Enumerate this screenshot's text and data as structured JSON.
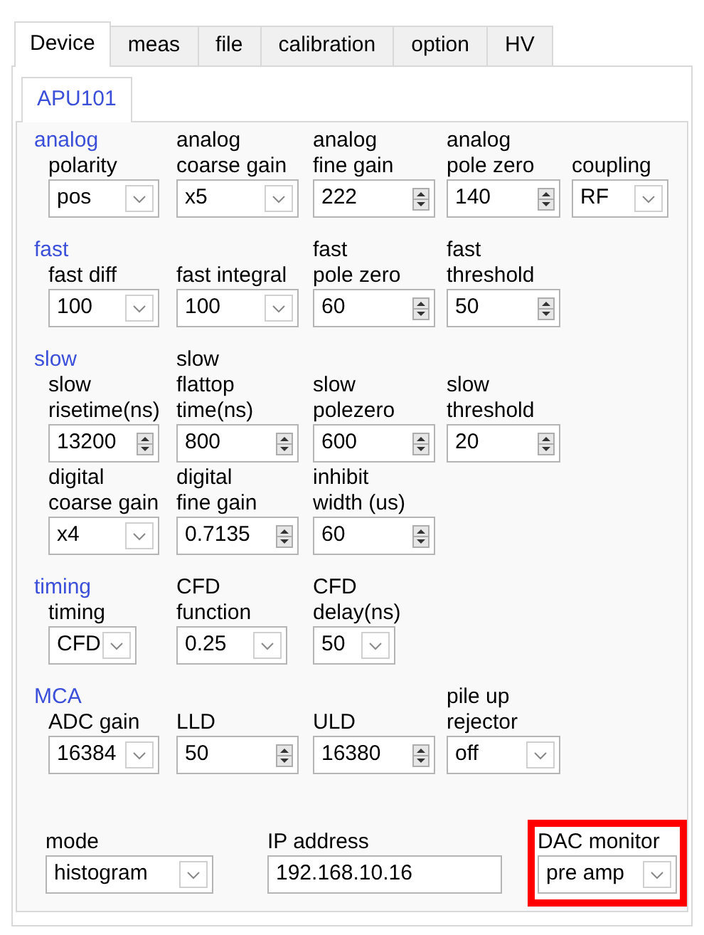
{
  "tabs": [
    {
      "label": "Device",
      "selected": true
    },
    {
      "label": "meas",
      "selected": false
    },
    {
      "label": "file",
      "selected": false
    },
    {
      "label": "calibration",
      "selected": false
    },
    {
      "label": "option",
      "selected": false
    },
    {
      "label": "HV",
      "selected": false
    }
  ],
  "subtabs": [
    {
      "label": "APU101",
      "selected": true
    }
  ],
  "sections": [
    {
      "heading": "analog",
      "rows": [
        [
          {
            "label_lines": [
              "polarity"
            ],
            "kind": "dropdown",
            "value": "pos"
          },
          {
            "label_lines": [
              "analog",
              "coarse gain"
            ],
            "kind": "dropdown",
            "value": "x5"
          },
          {
            "label_lines": [
              "analog",
              "fine gain"
            ],
            "kind": "spinner",
            "value": "222"
          },
          {
            "label_lines": [
              "analog",
              "pole zero"
            ],
            "kind": "spinner",
            "value": "140"
          },
          {
            "label_lines": [
              "coupling"
            ],
            "kind": "dropdown",
            "value": "RF"
          }
        ]
      ]
    },
    {
      "heading": "fast",
      "rows": [
        [
          {
            "label_lines": [
              "fast diff"
            ],
            "kind": "dropdown",
            "value": "100"
          },
          {
            "label_lines": [
              "fast integral"
            ],
            "kind": "dropdown",
            "value": "100"
          },
          {
            "label_lines": [
              "fast",
              "pole zero"
            ],
            "kind": "spinner",
            "value": "60"
          },
          {
            "label_lines": [
              "fast",
              "threshold"
            ],
            "kind": "spinner",
            "value": "50"
          }
        ]
      ]
    },
    {
      "heading": "slow",
      "rows": [
        [
          {
            "label_lines": [
              "slow",
              "risetime(ns)"
            ],
            "kind": "spinner",
            "value": "13200"
          },
          {
            "label_lines": [
              "slow",
              "flattop",
              "time(ns)"
            ],
            "kind": "spinner",
            "value": "800"
          },
          {
            "label_lines": [
              "slow",
              "polezero"
            ],
            "kind": "spinner",
            "value": "600"
          },
          {
            "label_lines": [
              "slow",
              "threshold"
            ],
            "kind": "spinner",
            "value": "20"
          }
        ],
        [
          {
            "label_lines": [
              "digital",
              "coarse gain"
            ],
            "kind": "dropdown",
            "value": "x4"
          },
          {
            "label_lines": [
              "digital",
              "fine gain"
            ],
            "kind": "spinner",
            "value": "0.7135"
          },
          {
            "label_lines": [
              "inhibit",
              "width (us)"
            ],
            "kind": "spinner",
            "value": "60"
          }
        ]
      ]
    },
    {
      "heading": "timing",
      "rows": [
        [
          {
            "label_lines": [
              "timing"
            ],
            "kind": "small_dropdown",
            "value": "CFD"
          },
          {
            "label_lines": [
              "CFD",
              "function"
            ],
            "kind": "small_dropdown",
            "value": "0.25"
          },
          {
            "label_lines": [
              "CFD",
              "delay(ns)"
            ],
            "kind": "small_dropdown",
            "value": "50"
          }
        ]
      ]
    },
    {
      "heading": "MCA",
      "rows": [
        [
          {
            "label_lines": [
              "ADC gain"
            ],
            "kind": "dropdown",
            "value": "16384"
          },
          {
            "label_lines": [
              "LLD"
            ],
            "kind": "spinner",
            "value": "50"
          },
          {
            "label_lines": [
              "ULD"
            ],
            "kind": "spinner",
            "value": "16380"
          },
          {
            "label_lines": [
              "pile up",
              "rejector"
            ],
            "kind": "dropdown",
            "value": "off"
          }
        ]
      ]
    }
  ],
  "footer": [
    {
      "label_lines": [
        "mode"
      ],
      "kind": "dropdown",
      "value": "histogram",
      "highlighted": false
    },
    {
      "label_lines": [
        "IP address"
      ],
      "kind": "text",
      "value": "192.168.10.16",
      "highlighted": false
    },
    {
      "label_lines": [
        "DAC monitor"
      ],
      "kind": "dropdown",
      "value": "pre amp",
      "highlighted": true
    }
  ]
}
